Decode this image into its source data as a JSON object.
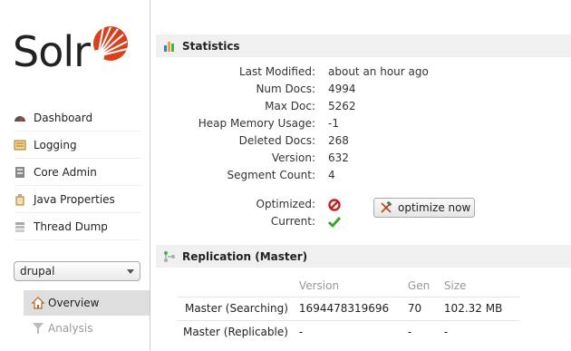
{
  "logo": {
    "text": "Solr"
  },
  "nav": [
    {
      "label": "Dashboard",
      "icon": "dashboard-icon"
    },
    {
      "label": "Logging",
      "icon": "logging-icon"
    },
    {
      "label": "Core Admin",
      "icon": "core-admin-icon"
    },
    {
      "label": "Java Properties",
      "icon": "java-properties-icon"
    },
    {
      "label": "Thread Dump",
      "icon": "thread-dump-icon"
    }
  ],
  "core_selector": {
    "value": "drupal"
  },
  "core_menu": [
    {
      "label": "Overview",
      "icon": "home-icon",
      "active": true
    },
    {
      "label": "Analysis",
      "icon": "filter-icon",
      "active": false
    }
  ],
  "statistics": {
    "title": "Statistics",
    "rows": [
      {
        "label": "Last Modified:",
        "value": "about an hour ago"
      },
      {
        "label": "Num Docs:",
        "value": "4994"
      },
      {
        "label": "Max Doc:",
        "value": "5262"
      },
      {
        "label": "Heap Memory Usage:",
        "value": "-1"
      },
      {
        "label": "Deleted Docs:",
        "value": "268"
      },
      {
        "label": "Version:",
        "value": "632"
      },
      {
        "label": "Segment Count:",
        "value": "4"
      }
    ],
    "optimized_label": "Optimized:",
    "current_label": "Current:",
    "optimize_button": "optimize now"
  },
  "replication": {
    "title": "Replication (Master)",
    "columns": [
      "Version",
      "Gen",
      "Size"
    ],
    "rows": [
      {
        "name": "Master (Searching)",
        "version": "1694478319696",
        "gen": "70",
        "size": "102.32 MB"
      },
      {
        "name": "Master (Replicable)",
        "version": "-",
        "gen": "-",
        "size": "-"
      }
    ]
  },
  "colors": {
    "solr_orange": "#d9411e",
    "ok_green": "#3aa52a",
    "error_red": "#c81e1e"
  }
}
